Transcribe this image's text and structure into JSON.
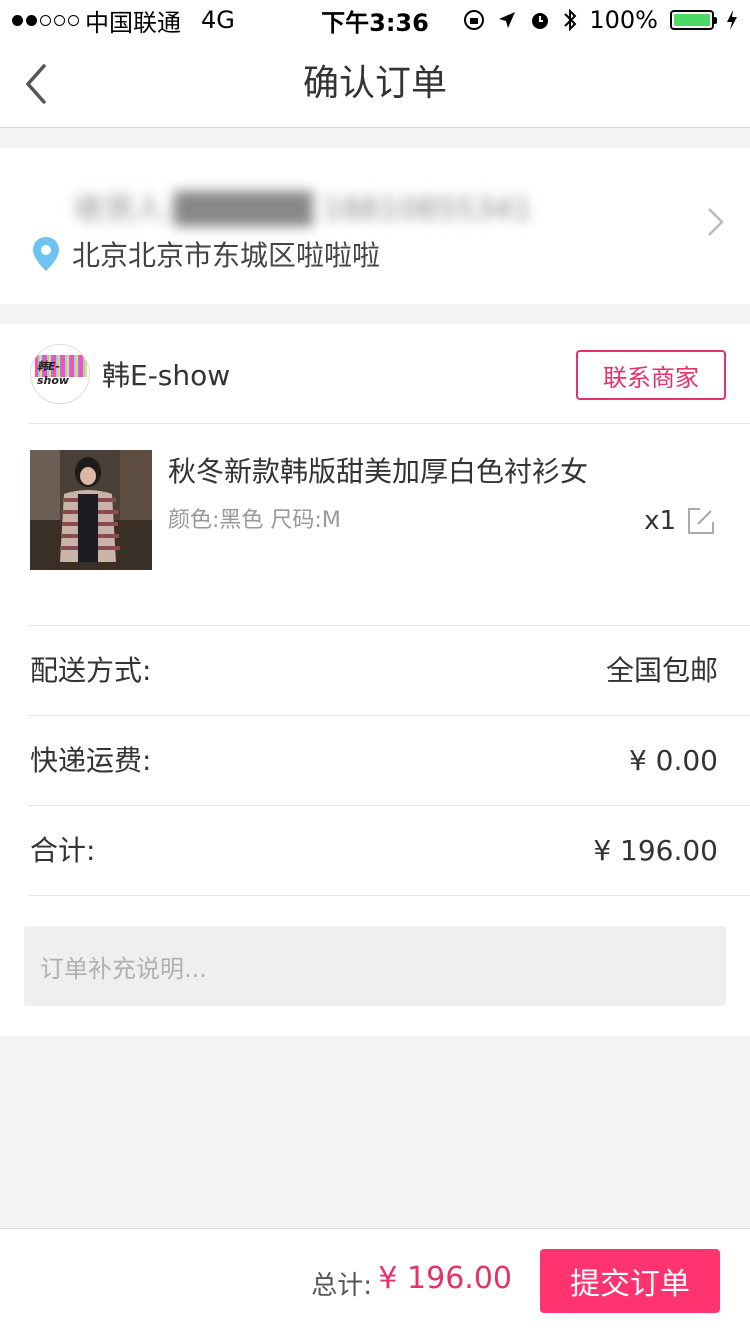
{
  "status_bar": {
    "carrier": "中国联通",
    "network": "4G",
    "time": "下午3:36",
    "battery": "100%"
  },
  "nav": {
    "title": "确认订单"
  },
  "address": {
    "recipient": "收货人:██████ 18810855341",
    "location": "北京北京市东城区啦啦啦"
  },
  "shop": {
    "name": "韩E-show",
    "logo_text": "韩E-show",
    "contact_label": "联系商家"
  },
  "product": {
    "title": "秋冬新款韩版甜美加厚白色衬衫女",
    "spec": "颜色:黑色 尺码:M",
    "quantity": "x1"
  },
  "summary": {
    "shipping_label": "配送方式:",
    "shipping_value": "全国包邮",
    "freight_label": "快递运费:",
    "freight_value": "¥  0.00",
    "subtotal_label": "合计:",
    "subtotal_value": "¥  196.00"
  },
  "note": {
    "placeholder": "订单补充说明..."
  },
  "footer": {
    "total_label": "总计:",
    "total_value": "¥  196.00",
    "submit_label": "提交订单"
  },
  "colors": {
    "accent": "#ff3370",
    "price": "#e5326b",
    "location_icon": "#6ec3f2"
  }
}
